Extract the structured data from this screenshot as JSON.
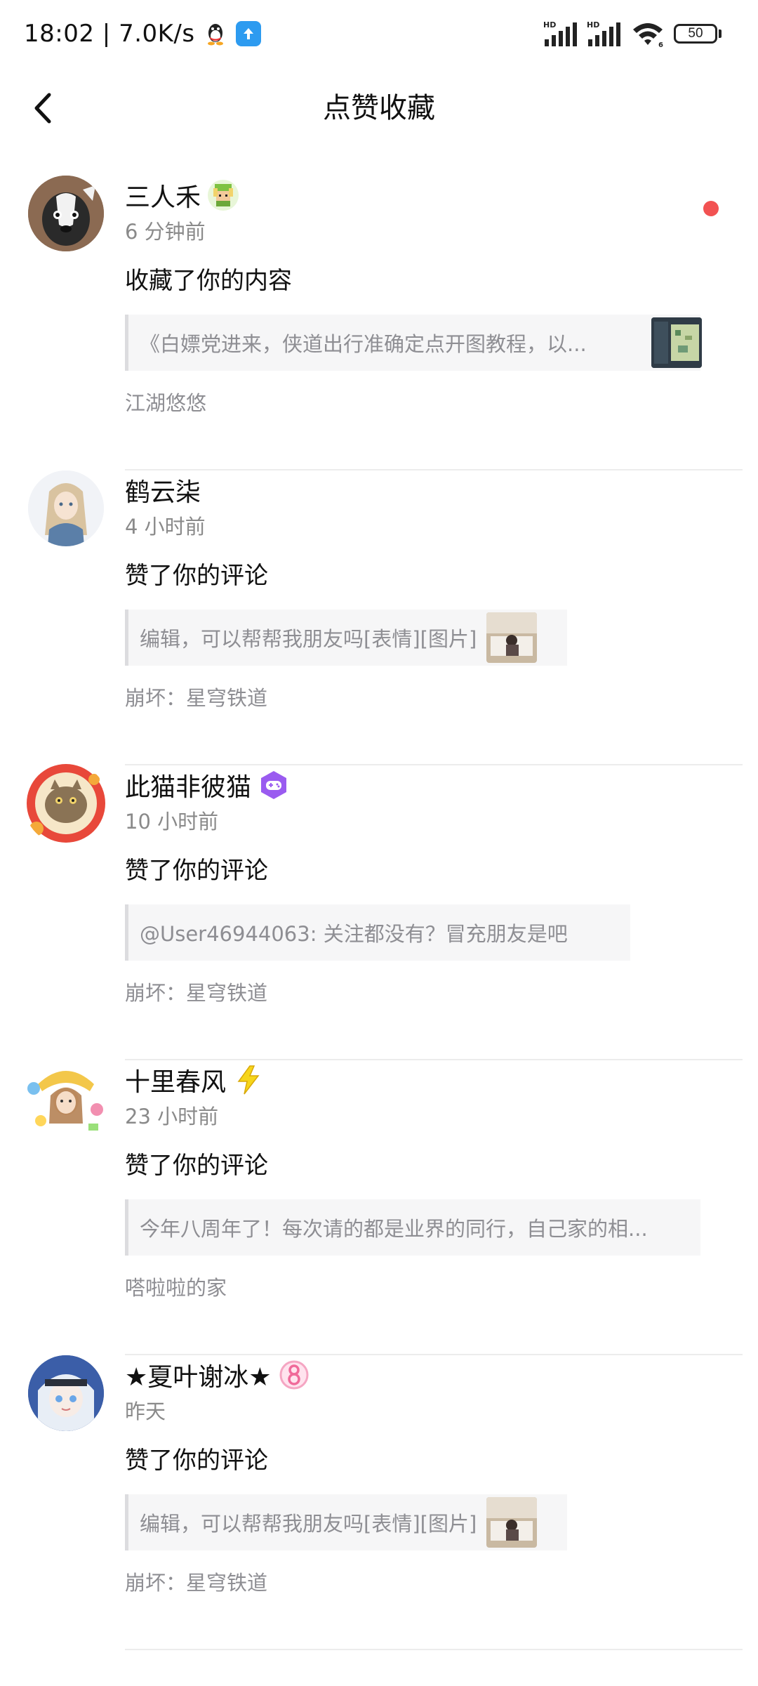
{
  "status_bar": {
    "time": "18:02",
    "network_speed": "7.0K/s",
    "battery": "50",
    "signal_1_label": "HD",
    "signal_2_label": "HD",
    "wifi_label": "6"
  },
  "header": {
    "title": "点赞收藏"
  },
  "notifications": [
    {
      "name": "三人禾",
      "time": "6 分钟前",
      "action": "收藏了你的内容",
      "quote": "《白嫖党进来，侠道出行准确定点开图教程，以...",
      "source": "江湖悠悠",
      "unread": true
    },
    {
      "name": "鹤云柒",
      "time": "4 小时前",
      "action": "赞了你的评论",
      "quote": "编辑，可以帮帮我朋友吗[表情][图片]",
      "source": "崩坏：星穹铁道",
      "unread": false
    },
    {
      "name": "此猫非彼猫",
      "time": "10 小时前",
      "action": "赞了你的评论",
      "quote": "@User46944063: 关注都没有？冒充朋友是吧",
      "source": "崩坏：星穹铁道",
      "unread": false
    },
    {
      "name": "十里春风",
      "time": "23 小时前",
      "action": "赞了你的评论",
      "quote": "今年八周年了！每次请的都是业界的同行，自己家的相...",
      "source": "嗒啦啦的家",
      "unread": false
    },
    {
      "name": "★夏叶谢冰★",
      "time": "昨天",
      "action": "赞了你的评论",
      "quote": "编辑，可以帮帮我朋友吗[表情][图片]",
      "source": "崩坏：星穹铁道",
      "unread": false
    }
  ],
  "colors": {
    "unread_dot": "#f25252",
    "quote_bg": "#f6f6f7",
    "secondary_text": "#8e8e93"
  }
}
